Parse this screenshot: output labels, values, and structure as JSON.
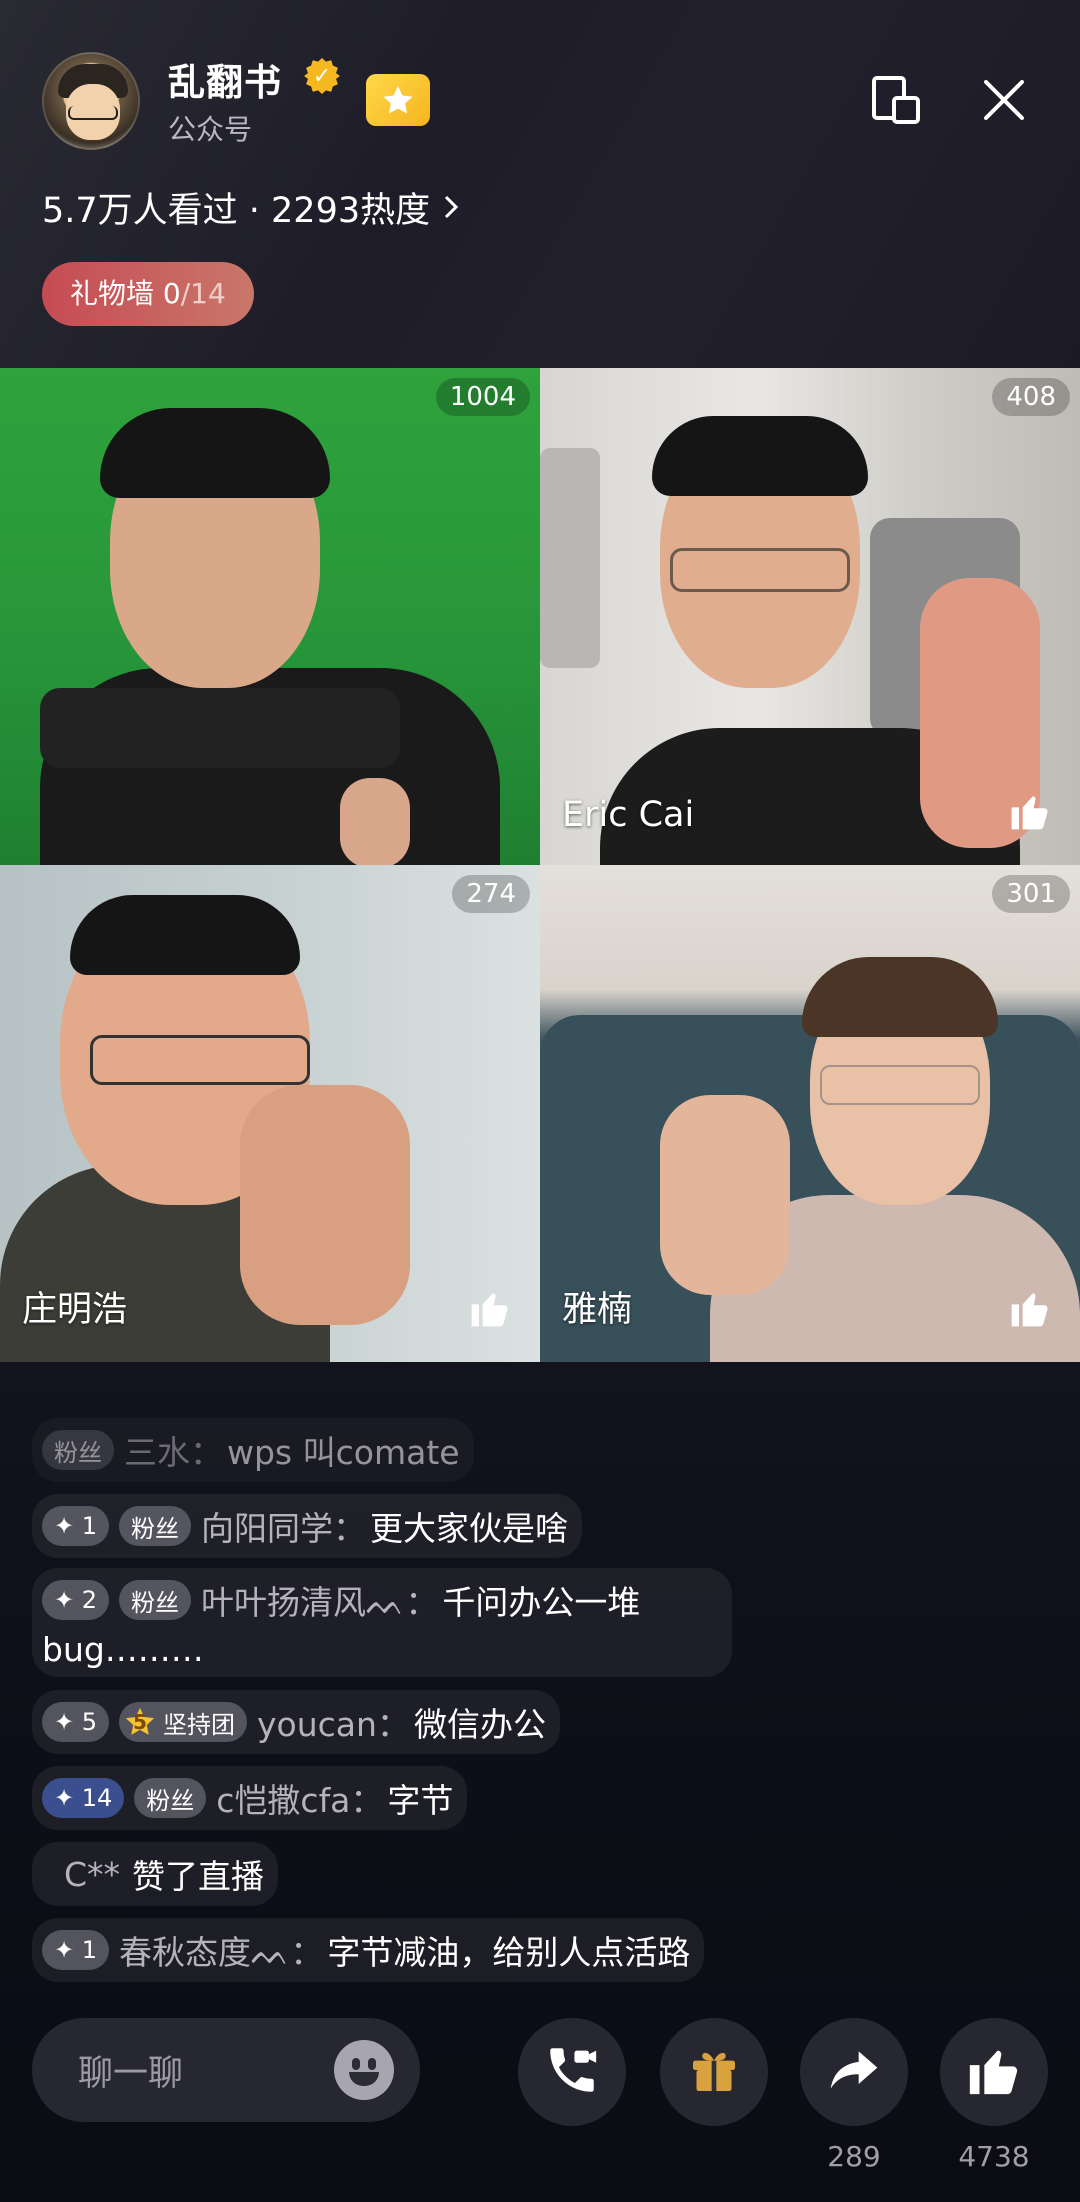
{
  "header": {
    "host_name": "乱翻书",
    "host_type": "公众号",
    "stats": "5.7万人看过 · 2293热度",
    "gift_wall_label": "礼物墙",
    "gift_wall_current": "0",
    "gift_wall_total": "/14"
  },
  "tiles": [
    {
      "count": "1004",
      "name": ""
    },
    {
      "count": "408",
      "name": "Eric Cai"
    },
    {
      "count": "274",
      "name": "庄明浩"
    },
    {
      "count": "301",
      "name": "雅楠"
    }
  ],
  "comments": [
    {
      "badges": [
        "粉丝"
      ],
      "user": "三水：",
      "text": "wps 叫comate"
    },
    {
      "badges": [
        "✦ 1",
        "粉丝"
      ],
      "user": "向阳同学：",
      "text": "更大家伙是啥"
    },
    {
      "badges": [
        "✦ 2",
        "粉丝"
      ],
      "user": "叶叶扬清风ᨓ：",
      "text": "千问办公一堆",
      "text2": "bug………"
    },
    {
      "badges": [
        "✦ 5",
        "坚持团"
      ],
      "team_level": "5",
      "user": "youcan：",
      "text": "微信办公"
    },
    {
      "badges": [
        "✦ 14",
        "粉丝"
      ],
      "user": "c恺撒cfa：",
      "text": "字节"
    },
    {
      "badges": [],
      "user": "C**",
      "text": "赞了直播"
    },
    {
      "badges": [
        "✦ 1"
      ],
      "user": "春秋态度ᨓ：",
      "text": "字节减油，给别人点活路"
    }
  ],
  "bottom_bar": {
    "input_placeholder": "聊一聊",
    "share_count": "289",
    "like_count": "4738"
  },
  "colors": {
    "gift_wall": "#c64b53",
    "verify": "#f5b820",
    "green_screen": "#2fa23c",
    "gift_icon": "#d9a23f"
  },
  "icons": [
    "verified-icon",
    "star-badge-icon",
    "float-window-icon",
    "close-icon",
    "chevron-right-icon",
    "thumbs-up-icon",
    "emoji-icon",
    "video-call-icon",
    "gift-icon",
    "share-icon"
  ]
}
